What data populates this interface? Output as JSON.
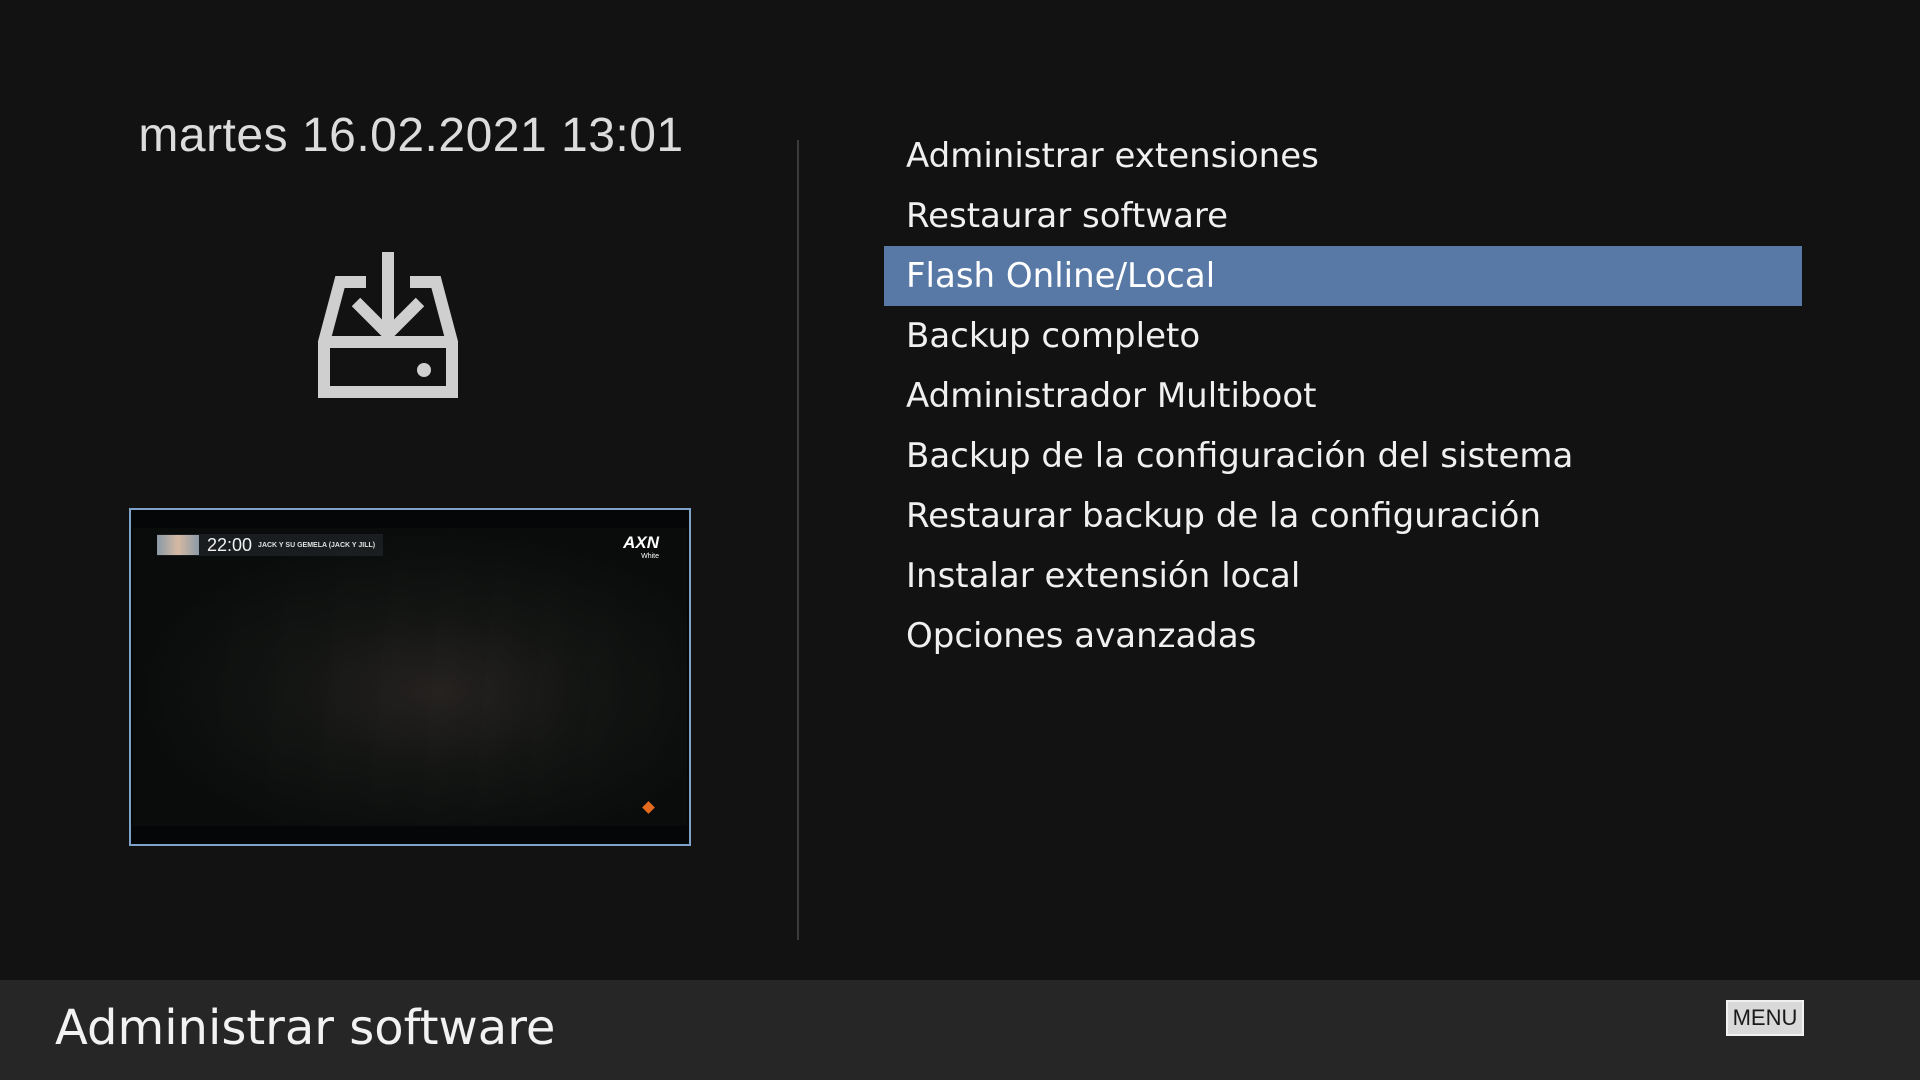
{
  "header": {
    "datetime": "martes 16.02.2021 13:01"
  },
  "icon": {
    "name": "download-tray-icon",
    "color": "#cfcfcf"
  },
  "pip": {
    "time": "22:00",
    "show_title": "JACK Y SU GEMELA (JACK Y JILL)",
    "channel_logo": "AXN",
    "channel_logo_sub": "White"
  },
  "menu": {
    "items": [
      {
        "label": "Administrar extensiones"
      },
      {
        "label": "Restaurar software"
      },
      {
        "label": "Flash Online/Local",
        "selected": true
      },
      {
        "label": "Backup completo"
      },
      {
        "label": "Administrador Multiboot"
      },
      {
        "label": "Backup de la configuración del sistema"
      },
      {
        "label": "Restaurar backup de la configuración"
      },
      {
        "label": "Instalar extensión local"
      },
      {
        "label": "Opciones avanzadas"
      }
    ],
    "selected_color": "#5879a6"
  },
  "footer": {
    "title": "Administrar software",
    "menu_key": "MENU"
  }
}
